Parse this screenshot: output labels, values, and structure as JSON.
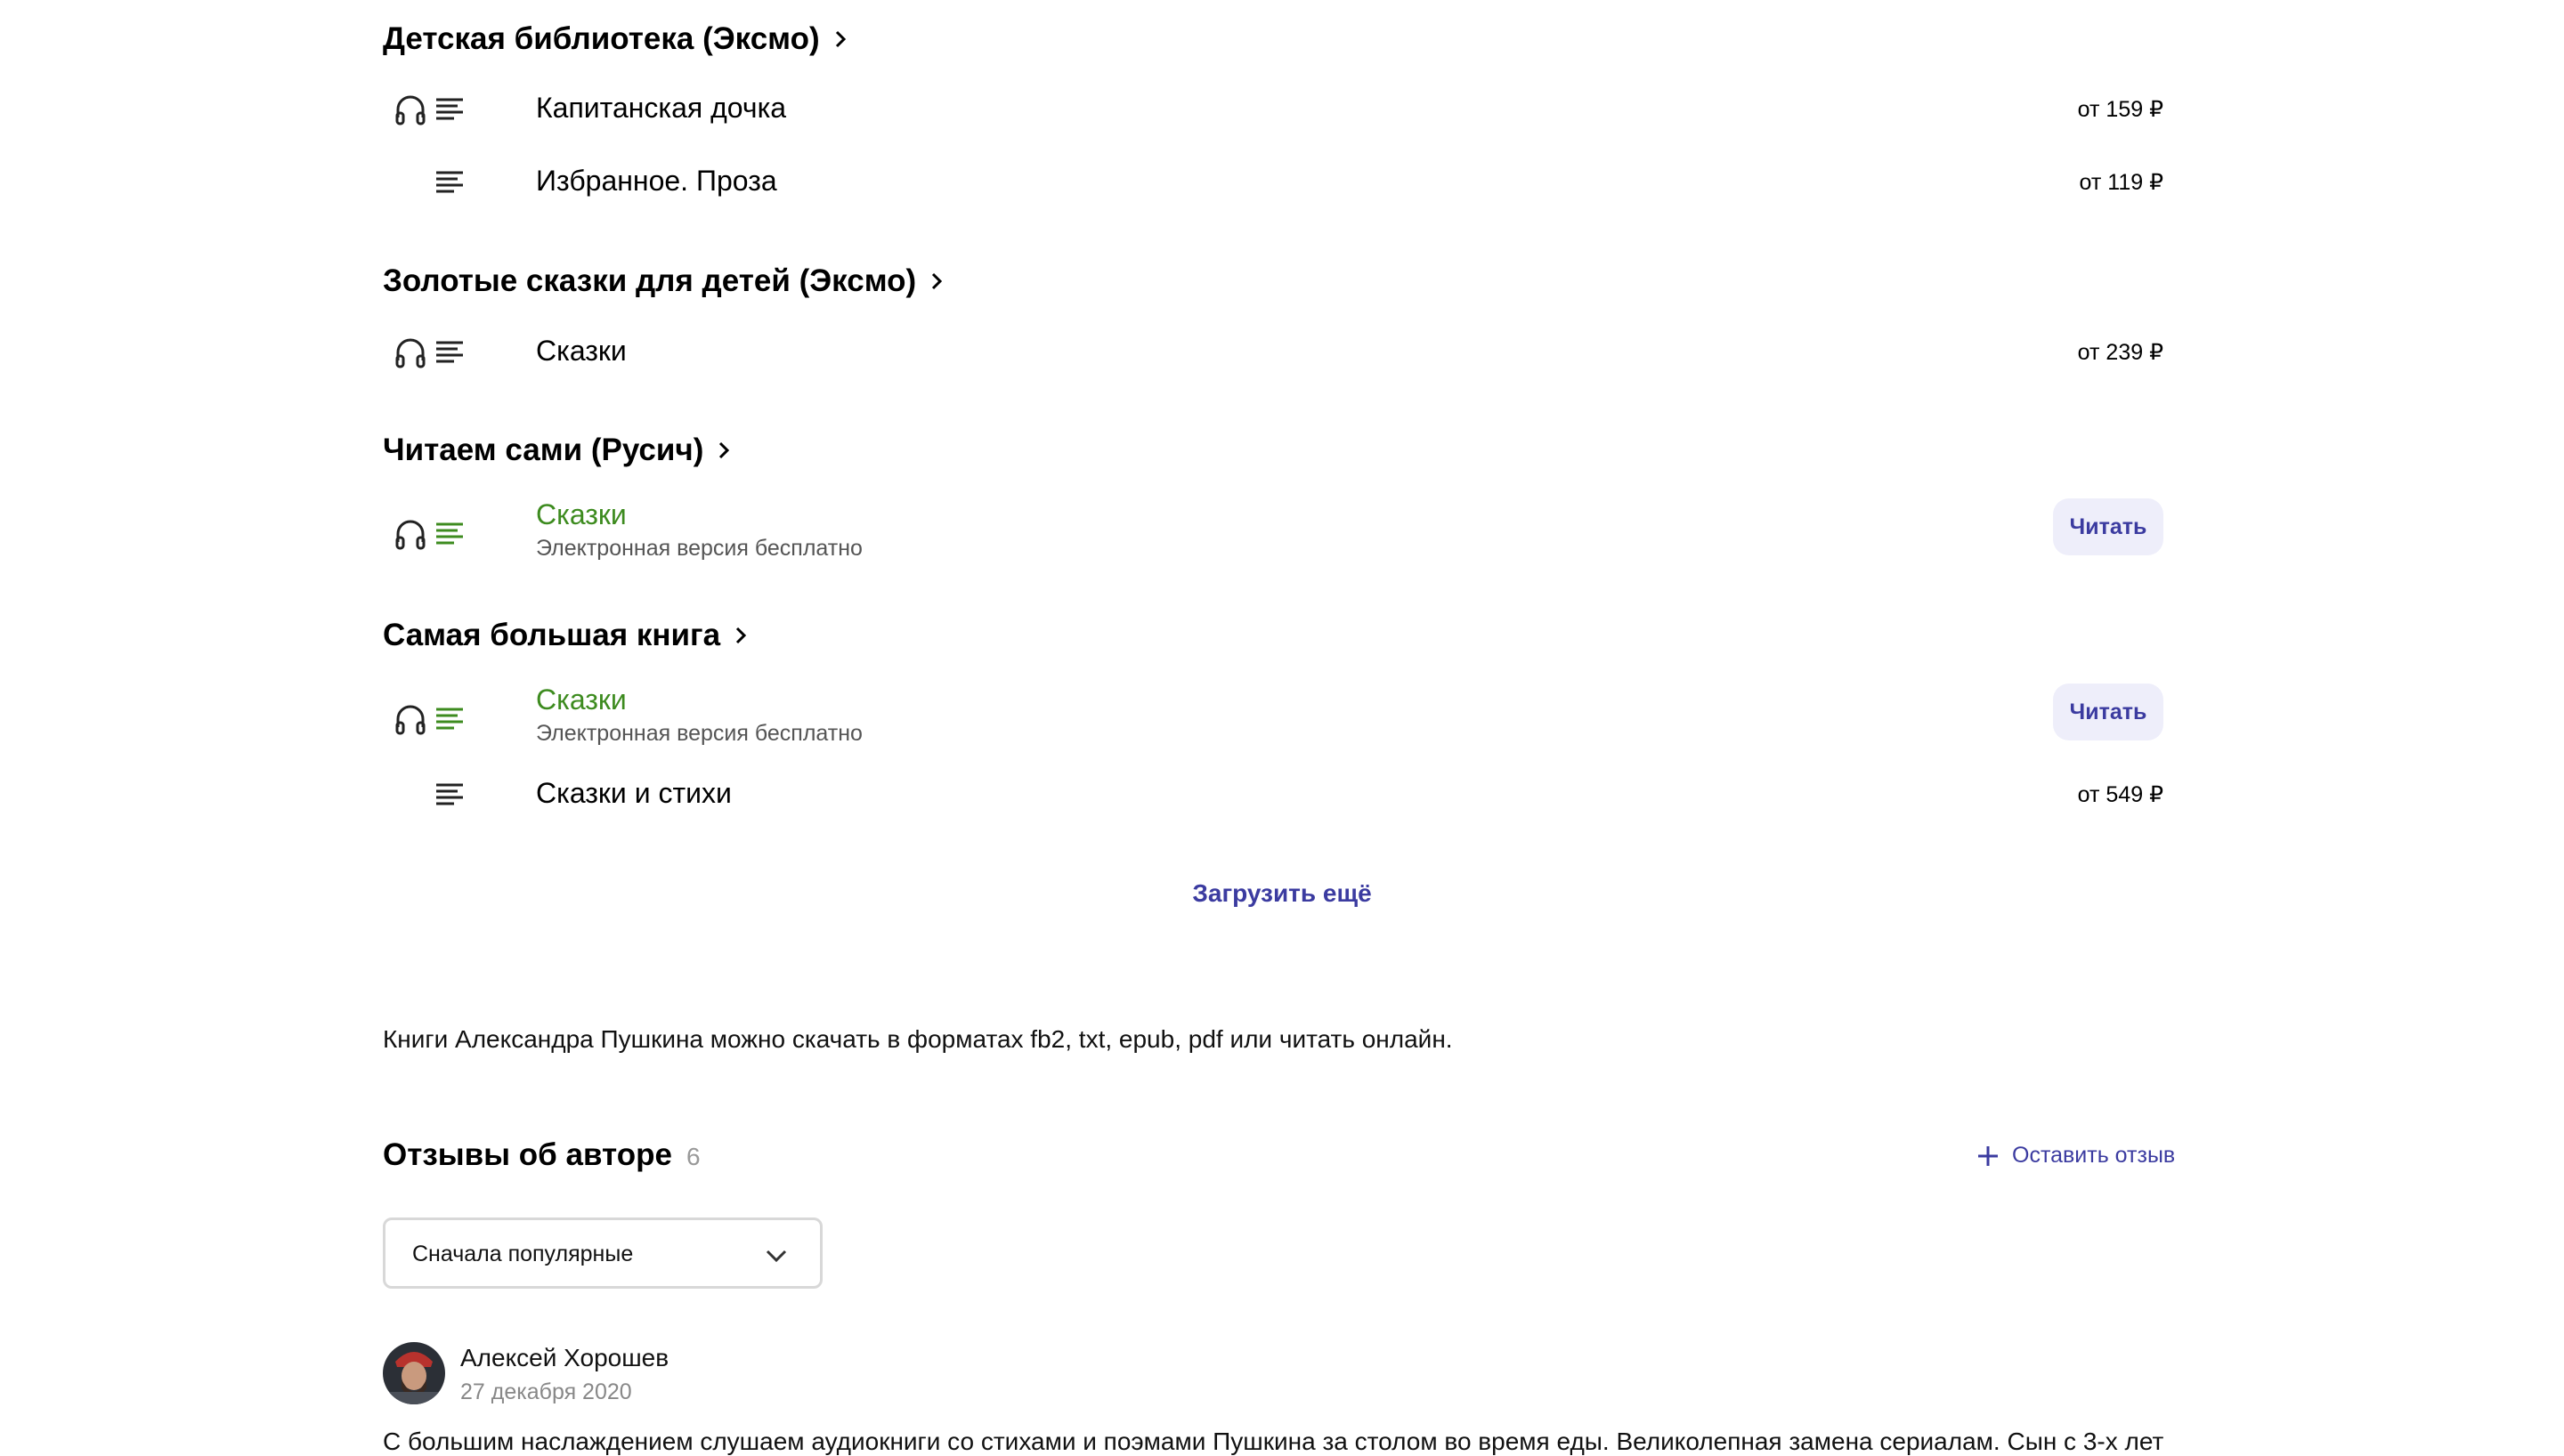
{
  "series": [
    {
      "title": "Детская библиотека (Эксмо)",
      "items": [
        {
          "title": "Капитанская дочка",
          "price": "от 159 ₽",
          "audio": true
        },
        {
          "title": "Избранное. Проза",
          "price": "от 119 ₽",
          "audio": false
        }
      ]
    },
    {
      "title": "Золотые сказки для детей (Эксмо)",
      "items": [
        {
          "title": "Сказки",
          "price": "от 239 ₽",
          "audio": true
        }
      ]
    },
    {
      "title": "Читаем сами (Русич)",
      "items": [
        {
          "title": "Сказки",
          "subtitle": "Электронная версия бесплатно",
          "button": "Читать",
          "audio": true,
          "free": true
        }
      ]
    },
    {
      "title": "Самая большая книга",
      "items": [
        {
          "title": "Сказки",
          "subtitle": "Электронная версия бесплатно",
          "button": "Читать",
          "audio": true,
          "free": true
        },
        {
          "title": "Сказки и стихи",
          "price": "от 549 ₽",
          "audio": false
        }
      ]
    }
  ],
  "load_more": "Загрузить ещё",
  "formats_text": "Книги Александра Пушкина можно скачать в форматах fb2, txt, epub, pdf или читать онлайн.",
  "reviews": {
    "title": "Отзывы об авторе",
    "count": "6",
    "leave_review": "Оставить отзыв",
    "sort": "Сначала популярные",
    "first": {
      "author": "Алексей Хорошев",
      "date": "27 декабря 2020",
      "text": "С большим наслаждением слушаем аудиокниги со стихами и поэмами Пушкина за столом во время еды. Великолепная замена сериалам. Сын с 3-х лет"
    }
  },
  "colors": {
    "accent": "#3b3ba0",
    "free_green": "#3d8b1f",
    "button_bg": "#eeeefa"
  }
}
